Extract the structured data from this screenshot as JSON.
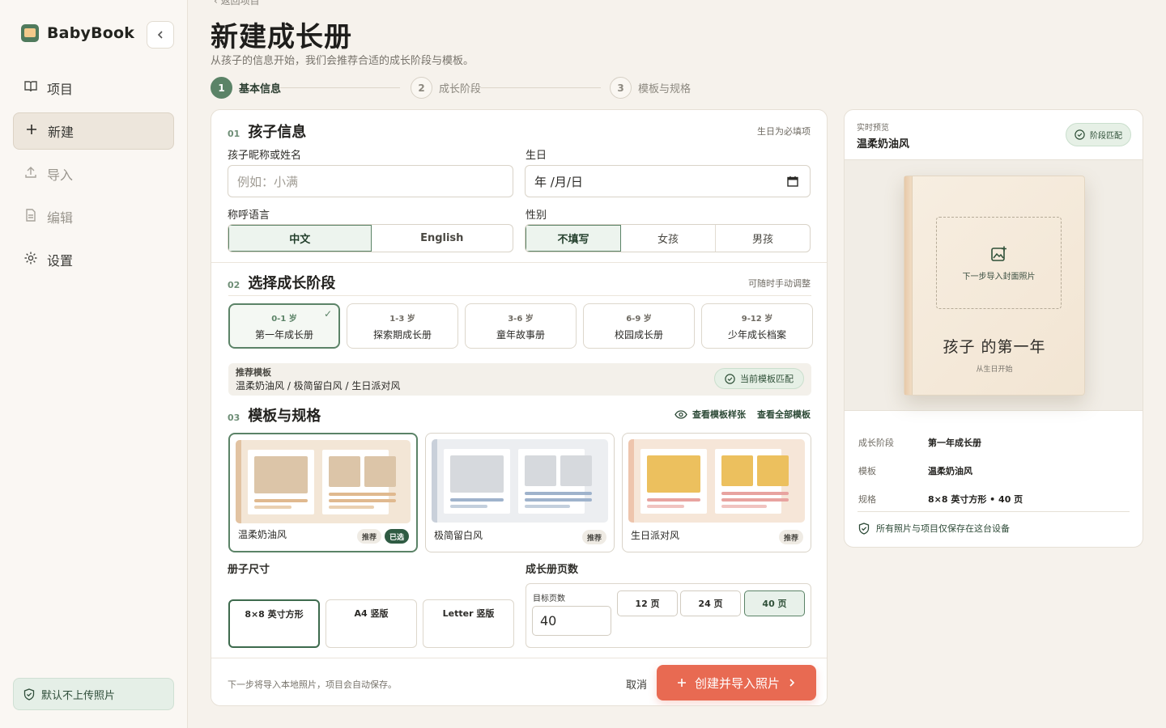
{
  "app": {
    "name": "BabyBook"
  },
  "sidebar": {
    "collapse_icon": "chevron-left-icon",
    "items": [
      {
        "label": "项目",
        "icon": "book-icon",
        "state": "normal"
      },
      {
        "label": "新建",
        "icon": "plus-icon",
        "state": "active"
      },
      {
        "label": "导入",
        "icon": "upload-icon",
        "state": "disabled"
      },
      {
        "label": "编辑",
        "icon": "document-icon",
        "state": "disabled"
      },
      {
        "label": "设置",
        "icon": "gear-icon",
        "state": "normal"
      }
    ],
    "privacy_badge": "默认不上传照片"
  },
  "header": {
    "back_link": "‹ 返回项目",
    "title": "新建成长册",
    "subtitle": "从孩子的信息开始，我们会推荐合适的成长阶段与模板。"
  },
  "stepper": [
    {
      "num": "1",
      "label": "基本信息",
      "active": true
    },
    {
      "num": "2",
      "label": "成长阶段",
      "active": false
    },
    {
      "num": "3",
      "label": "模板与规格",
      "active": false
    }
  ],
  "section1": {
    "num": "01",
    "title": "孩子信息",
    "hint": "生日为必填项",
    "name_label": "孩子昵称或姓名",
    "name_placeholder": "例如：小满",
    "birthday_label": "生日",
    "birthday_value": "年 /月/日",
    "lang_label": "称呼语言",
    "lang_options": [
      "中文",
      "English"
    ],
    "lang_selected": 0,
    "gender_label": "性别",
    "gender_options": [
      "不填写",
      "女孩",
      "男孩"
    ],
    "gender_selected": 0
  },
  "section2": {
    "num": "02",
    "title": "选择成长阶段",
    "hint": "可随时手动调整",
    "stages": [
      {
        "age": "0-1 岁",
        "name": "第一年成长册"
      },
      {
        "age": "1-3 岁",
        "name": "探索期成长册"
      },
      {
        "age": "3-6 岁",
        "name": "童年故事册"
      },
      {
        "age": "6-9 岁",
        "name": "校园成长册"
      },
      {
        "age": "9-12 岁",
        "name": "少年成长档案"
      }
    ],
    "stage_selected": 0,
    "rec_label": "推荐模板",
    "rec_value": "温柔奶油风 / 极简留白风 / 生日派对风",
    "match_label": "当前模板匹配"
  },
  "section3": {
    "num": "03",
    "title": "模板与规格",
    "link_preview": "查看模板样张",
    "link_all": "查看全部模板",
    "templates": [
      {
        "name": "温柔奶油风",
        "tags": [
          "推荐",
          "已选"
        ],
        "accent": "#d8c3a5",
        "bar": "#e0b98f"
      },
      {
        "name": "极简留白风",
        "tags": [
          "推荐"
        ],
        "accent": "#d6d9dd",
        "bar": "#9fb3cc"
      },
      {
        "name": "生日派对风",
        "tags": [
          "推荐"
        ],
        "accent": "#ecc05e",
        "bar": "#e8a3a0"
      }
    ],
    "template_selected": 0,
    "size_label": "册子尺寸",
    "sizes": [
      "8×8 英寸方形",
      "A4 竖版",
      "Letter 竖版"
    ],
    "size_selected": 0,
    "pages_label": "成长册页数",
    "target_label": "目标页数",
    "target_value": "40",
    "page_chips": [
      "12 页",
      "24 页",
      "40 页"
    ],
    "page_selected": 2
  },
  "footer": {
    "note": "下一步将导入本地照片，项目会自动保存。",
    "cancel": "取消",
    "primary": "创建并导入照片"
  },
  "preview": {
    "kicker": "实时预览",
    "template_name": "温柔奶油风",
    "pill": "阶段匹配",
    "photo_hint": "下一步导入封面照片",
    "book_title": "孩子 的第一年",
    "book_sub": "从生日开始",
    "rows": [
      {
        "k": "成长阶段",
        "v": "第一年成长册"
      },
      {
        "k": "模板",
        "v": "温柔奶油风"
      },
      {
        "k": "规格",
        "v": "8×8 英寸方形 • 40 页"
      }
    ],
    "safe_note": "所有照片与项目仅保存在这台设备"
  },
  "colors": {
    "accent_green": "#5b8367",
    "primary_orange": "#e86a52",
    "bg": "#f6f2ec"
  }
}
